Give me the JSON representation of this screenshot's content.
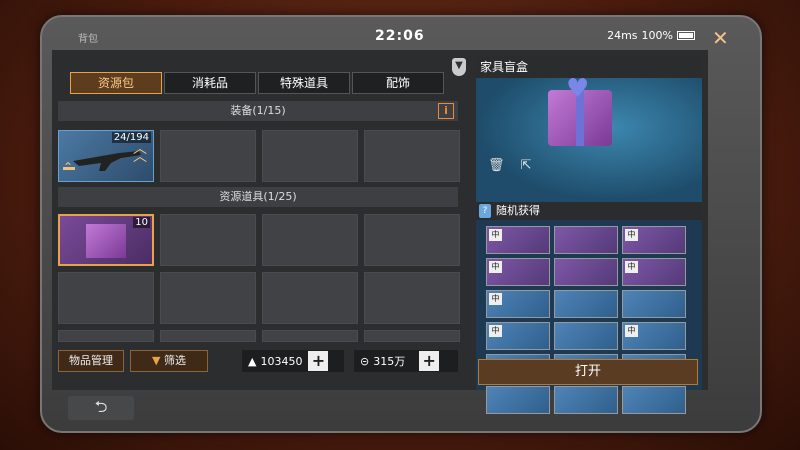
{
  "status": {
    "app_title": "背包",
    "clock": "22:06",
    "latency": "24ms",
    "battery": "100%"
  },
  "tabs": [
    {
      "label": "资源包",
      "active": true
    },
    {
      "label": "消耗品",
      "active": false
    },
    {
      "label": "特殊道具",
      "active": false
    },
    {
      "label": "配饰",
      "active": false
    }
  ],
  "sections": {
    "equipment": {
      "title": "装备(1/15)",
      "weapon_count": "24/194"
    },
    "resources": {
      "title": "资源道具(1/25)",
      "box_count": "10"
    }
  },
  "bottom": {
    "manage_label": "物品管理",
    "filter_label": "筛选",
    "currency1_value": "103450",
    "currency2_value": "315万"
  },
  "detail": {
    "title": "家具盲盒",
    "random_label": "随机获得",
    "open_label": "打开",
    "loot": [
      {
        "tier": "中",
        "rarity": "purple"
      },
      {
        "tier": "",
        "rarity": "purple"
      },
      {
        "tier": "中",
        "rarity": "purple"
      },
      {
        "tier": "中",
        "rarity": "purple"
      },
      {
        "tier": "",
        "rarity": "purple"
      },
      {
        "tier": "中",
        "rarity": "purple"
      },
      {
        "tier": "中",
        "rarity": "blue"
      },
      {
        "tier": "",
        "rarity": "blue"
      },
      {
        "tier": "",
        "rarity": "blue"
      },
      {
        "tier": "中",
        "rarity": "blue"
      },
      {
        "tier": "",
        "rarity": "blue"
      },
      {
        "tier": "中",
        "rarity": "blue"
      },
      {
        "tier": "",
        "rarity": "blue"
      },
      {
        "tier": "",
        "rarity": "blue"
      },
      {
        "tier": "",
        "rarity": "blue"
      },
      {
        "tier": "",
        "rarity": "blue"
      },
      {
        "tier": "",
        "rarity": "blue"
      },
      {
        "tier": "",
        "rarity": "blue"
      }
    ]
  }
}
